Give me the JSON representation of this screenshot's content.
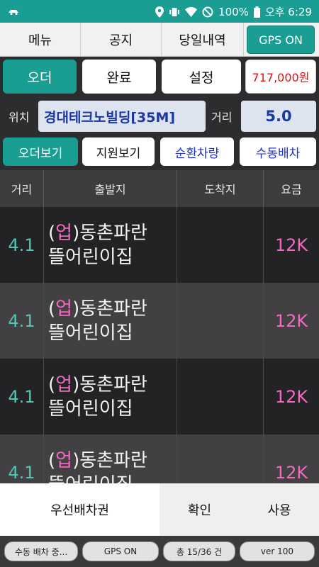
{
  "status_bar": {
    "battery": "100%",
    "time": "오후 6:29"
  },
  "top_menu": {
    "menu": "메뉴",
    "notice": "공지",
    "today": "당일내역",
    "gps": "GPS ON"
  },
  "actions": {
    "order": "오더",
    "complete": "완료",
    "settings": "설정",
    "amount": "717,000원"
  },
  "location": {
    "label": "위치",
    "value": "경대테크노빌딩[35M]",
    "distance_label": "거리",
    "distance_value": "5.0"
  },
  "filters": {
    "order_view": "오더보기",
    "support_view": "지원보기",
    "circulation": "순환차량",
    "manual": "수동배차"
  },
  "table": {
    "headers": [
      "거리",
      "출발지",
      "도착지",
      "요금"
    ],
    "rows": [
      {
        "distance": "4.1",
        "tag": "업",
        "from_line1": "동촌파란",
        "from_line2": "뜰어린이집",
        "to": "",
        "fee": "12K"
      },
      {
        "distance": "4.1",
        "tag": "업",
        "from_line1": "동촌파란",
        "from_line2": "뜰어린이집",
        "to": "",
        "fee": "12K"
      },
      {
        "distance": "4.1",
        "tag": "업",
        "from_line1": "동촌파란",
        "from_line2": "뜰어린이집",
        "to": "",
        "fee": "12K"
      },
      {
        "distance": "4.1",
        "tag": "업",
        "from_line1": "동촌파란",
        "from_line2": "뜰어린이집",
        "to": "",
        "fee": "12K"
      }
    ]
  },
  "bottom": {
    "priority": "우선배차권",
    "confirm": "확인",
    "use": "사용"
  },
  "footer": {
    "mode": "수동 배차 중...",
    "gps": "GPS ON",
    "count": "총 15/36 건",
    "version": "ver 100"
  },
  "colors": {
    "accent": "#1a9e93",
    "fee": "#f06ac0",
    "distance": "#4fc8b8",
    "amount": "#e01010"
  }
}
